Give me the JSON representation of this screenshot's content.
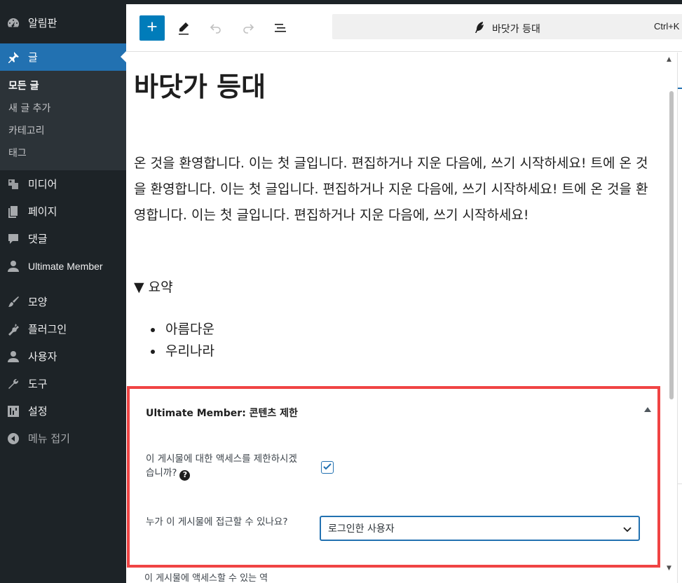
{
  "sidebar": {
    "dashboard": "알림판",
    "posts": "글",
    "posts_sub": [
      "모든 글",
      "새 글 추가",
      "카테고리",
      "태그"
    ],
    "media": "미디어",
    "pages": "페이지",
    "comments": "댓글",
    "ultimate_member": "Ultimate Member",
    "appearance": "모양",
    "plugins": "플러그인",
    "users": "사용자",
    "tools": "도구",
    "settings": "설정",
    "collapse": "메뉴 접기"
  },
  "toolbar": {
    "document_title": "바닷가 등대",
    "shortcut": "Ctrl+K"
  },
  "post": {
    "title": "바닷가 등대",
    "paragraph": "온 것을 환영합니다. 이는 첫 글입니다. 편집하거나 지운 다음에, 쓰기 시작하세요! 트에 온 것을 환영합니다. 이는 첫 글입니다. 편집하거나 지운 다음에, 쓰기 시작하세요! 트에 온 것을 환영합니다. 이는 첫 글입니다. 편집하거나 지운 다음에, 쓰기 시작하세요!",
    "details_summary": "▼ 요약",
    "list_items": [
      "아름다운",
      "우리나라"
    ]
  },
  "metabox": {
    "title": "Ultimate Member: 콘텐츠 제한",
    "restrict_label": "이 게시물에 대한 액세스를 제한하시겠습니까?",
    "restrict_checked": true,
    "who_label": "누가 이 게시물에 접근할 수 있나요?",
    "who_value": "로그인한 사용자",
    "help_icon": "?"
  },
  "partial_below": "이 게시물에 액세스할 수 있는 역"
}
